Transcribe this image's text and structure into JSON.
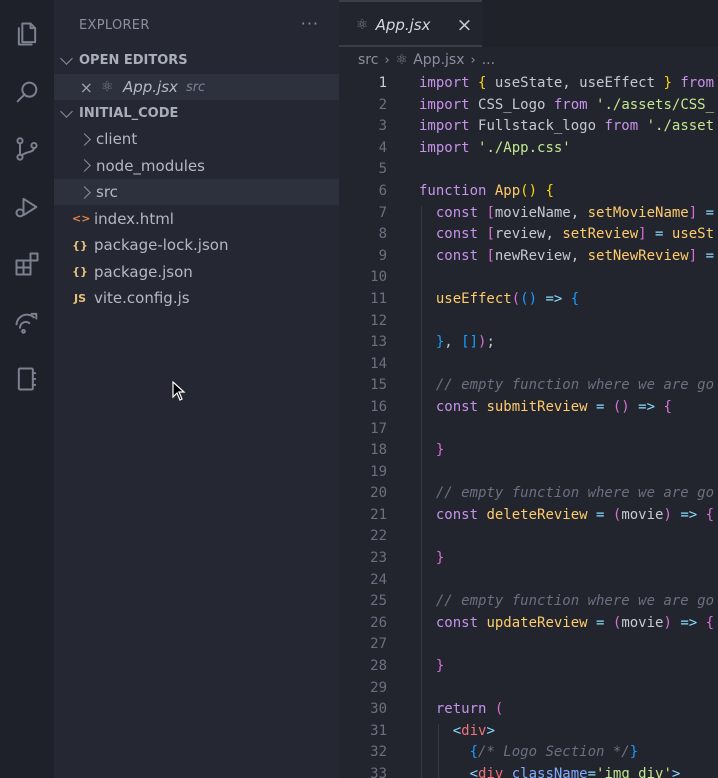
{
  "activity_bar": {
    "icons": [
      "files-icon",
      "search-icon",
      "source-control-icon",
      "run-debug-icon",
      "extensions-icon",
      "remote-icon",
      "notebook-icon"
    ]
  },
  "sidebar": {
    "title": "EXPLORER",
    "more": "···",
    "open_editors_label": "OPEN EDITORS",
    "open_editor": {
      "name": "App.jsx",
      "path": "src"
    },
    "project_label": "INITIAL_CODE",
    "tree": [
      {
        "type": "folder",
        "name": "client"
      },
      {
        "type": "folder",
        "name": "node_modules"
      },
      {
        "type": "folder",
        "name": "src",
        "selected": true
      },
      {
        "type": "file",
        "name": "index.html",
        "icon": "<>",
        "color": "#e8844a"
      },
      {
        "type": "file",
        "name": "package-lock.json",
        "icon": "{}",
        "color": "#e5c07b"
      },
      {
        "type": "file",
        "name": "package.json",
        "icon": "{}",
        "color": "#e5c07b"
      },
      {
        "type": "file",
        "name": "vite.config.js",
        "icon": "JS",
        "color": "#e5c07b"
      }
    ]
  },
  "editor": {
    "tab": {
      "name": "App.jsx",
      "close": "×"
    },
    "breadcrumb": [
      "src",
      "App.jsx",
      "..."
    ],
    "active_line": 1,
    "lines": [
      [
        [
          "kw",
          "import "
        ],
        [
          "br1",
          "{ "
        ],
        [
          "var",
          "useState, useEffect "
        ],
        [
          "br1",
          "} "
        ],
        [
          "kw",
          "from"
        ]
      ],
      [
        [
          "kw",
          "import "
        ],
        [
          "var",
          "CSS_Logo "
        ],
        [
          "kw",
          "from "
        ],
        [
          "str",
          "'./assets/CSS_"
        ]
      ],
      [
        [
          "kw",
          "import "
        ],
        [
          "var",
          "Fullstack_logo "
        ],
        [
          "kw",
          "from "
        ],
        [
          "str",
          "'./asset"
        ]
      ],
      [
        [
          "kw",
          "import "
        ],
        [
          "str",
          "'./App.css'"
        ]
      ],
      [],
      [
        [
          "kw",
          "function "
        ],
        [
          "fn",
          "App"
        ],
        [
          "br1",
          "() {"
        ]
      ],
      [
        [
          "kw",
          "  const "
        ],
        [
          "br2",
          "["
        ],
        [
          "var",
          "movieName, "
        ],
        [
          "fn",
          "setMovieName"
        ],
        [
          "br2",
          "] "
        ],
        [
          "pn",
          "="
        ]
      ],
      [
        [
          "kw",
          "  const "
        ],
        [
          "br2",
          "["
        ],
        [
          "var",
          "review, "
        ],
        [
          "fn",
          "setReview"
        ],
        [
          "br2",
          "] "
        ],
        [
          "pn",
          "= "
        ],
        [
          "fn",
          "useSt"
        ]
      ],
      [
        [
          "kw",
          "  const "
        ],
        [
          "br2",
          "["
        ],
        [
          "var",
          "newReview, "
        ],
        [
          "fn",
          "setNewReview"
        ],
        [
          "br2",
          "] "
        ],
        [
          "pn",
          "="
        ]
      ],
      [],
      [
        [
          "fn",
          "  useEffect"
        ],
        [
          "br2",
          "("
        ],
        [
          "br3",
          "() "
        ],
        [
          "pn",
          "=> "
        ],
        [
          "br3",
          "{"
        ]
      ],
      [],
      [
        [
          "br3",
          "  }"
        ],
        [
          "var",
          ", "
        ],
        [
          "br3",
          "[]"
        ],
        [
          "br2",
          ")"
        ],
        [
          "var",
          ";"
        ]
      ],
      [],
      [
        [
          "cm",
          "  // empty function where we are go"
        ]
      ],
      [
        [
          "kw",
          "  const "
        ],
        [
          "fn",
          "submitReview "
        ],
        [
          "pn",
          "= "
        ],
        [
          "br2",
          "() "
        ],
        [
          "pn",
          "=> "
        ],
        [
          "br2",
          "{"
        ]
      ],
      [],
      [
        [
          "br2",
          "  }"
        ]
      ],
      [],
      [
        [
          "cm",
          "  // empty function where we are go"
        ]
      ],
      [
        [
          "kw",
          "  const "
        ],
        [
          "fn",
          "deleteReview "
        ],
        [
          "pn",
          "= "
        ],
        [
          "br2",
          "("
        ],
        [
          "param",
          "movie"
        ],
        [
          "br2",
          ") "
        ],
        [
          "pn",
          "=> "
        ],
        [
          "br2",
          "{"
        ]
      ],
      [],
      [
        [
          "br2",
          "  }"
        ]
      ],
      [],
      [
        [
          "cm",
          "  // empty function where we are go"
        ]
      ],
      [
        [
          "kw",
          "  const "
        ],
        [
          "fn",
          "updateReview "
        ],
        [
          "pn",
          "= "
        ],
        [
          "br2",
          "("
        ],
        [
          "param",
          "movie"
        ],
        [
          "br2",
          ") "
        ],
        [
          "pn",
          "=> "
        ],
        [
          "br2",
          "{"
        ]
      ],
      [],
      [
        [
          "br2",
          "  }"
        ]
      ],
      [],
      [
        [
          "kw",
          "  return "
        ],
        [
          "br2",
          "("
        ]
      ],
      [
        [
          "pn",
          "    <"
        ],
        [
          "tag",
          "div"
        ],
        [
          "pn",
          ">"
        ]
      ],
      [
        [
          "br3",
          "      {"
        ],
        [
          "cm",
          "/* Logo Section */"
        ],
        [
          "br3",
          "}"
        ]
      ],
      [
        [
          "pn",
          "      <"
        ],
        [
          "tag",
          "div "
        ],
        [
          "fn2",
          "className"
        ],
        [
          "pn",
          "="
        ],
        [
          "str",
          "'img_div'"
        ],
        [
          "pn",
          ">"
        ]
      ]
    ]
  }
}
